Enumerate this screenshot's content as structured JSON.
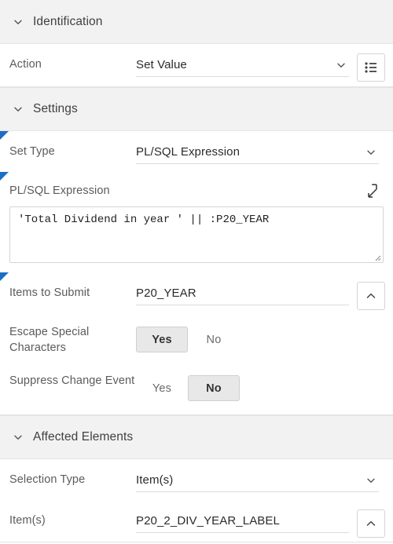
{
  "sections": [
    {
      "title": "Identification",
      "expanded": true
    },
    {
      "title": "Settings",
      "expanded": true
    },
    {
      "title": "Affected Elements",
      "expanded": true
    }
  ],
  "identification": {
    "action": {
      "label": "Action",
      "value": "Set Value",
      "icon": "list-icon"
    }
  },
  "settings": {
    "set_type": {
      "label": "Set Type",
      "value": "PL/SQL Expression",
      "required": true
    },
    "plsql_expression": {
      "label": "PL/SQL Expression",
      "value": "'Total Dividend in year ' || :P20_YEAR",
      "required": true,
      "expand_icon": "expand-icon"
    },
    "items_to_submit": {
      "label": "Items to Submit",
      "value": "P20_YEAR",
      "required": true,
      "icon": "chevron-up-icon"
    },
    "escape_special_characters": {
      "label": "Escape Special Characters",
      "options": [
        "Yes",
        "No"
      ],
      "selected": "Yes"
    },
    "suppress_change_event": {
      "label": "Suppress Change Event",
      "options": [
        "Yes",
        "No"
      ],
      "selected": "No"
    }
  },
  "affected_elements": {
    "selection_type": {
      "label": "Selection Type",
      "value": "Item(s)"
    },
    "items": {
      "label": "Item(s)",
      "value": "P20_2_DIV_YEAR_LABEL",
      "icon": "chevron-up-icon"
    }
  },
  "colors": {
    "required_marker": "#1b6ec2",
    "section_header_bg": "#f2f2f2",
    "toggle_selected_bg": "#e8e8e8",
    "underline": "#dcdcdc",
    "label_text": "#5b5b5b",
    "value_text": "#2b2b2b"
  }
}
